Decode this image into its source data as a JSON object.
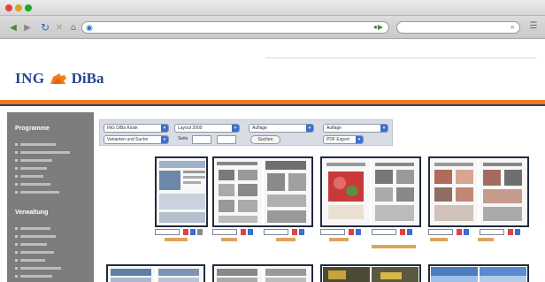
{
  "brand": {
    "name_left": "ING",
    "name_right": "DiBa",
    "orange": "#f27b1a",
    "blue": "#26458c"
  },
  "toolbar": {
    "back_icon": "back-arrow-icon",
    "forward_icon": "forward-arrow-icon",
    "reload_icon": "reload-icon",
    "stop_icon": "stop-icon",
    "home_icon": "home-icon",
    "search_icon": "magnifier-icon",
    "menu_icon": "bookmarks-icon"
  },
  "sidebar": {
    "section1": "Programme",
    "section2": "Verwaltung"
  },
  "filters": {
    "select1": "ING DiBa Kiosk",
    "select2": "Layout 2009",
    "select3": "Auflage",
    "select4": "Auflage",
    "select5": "Varianten und Suche",
    "label_seite": "Seite",
    "button_suchen": "Suchen",
    "select6": "PDF Export"
  },
  "thumbnails": {
    "count": 8
  }
}
